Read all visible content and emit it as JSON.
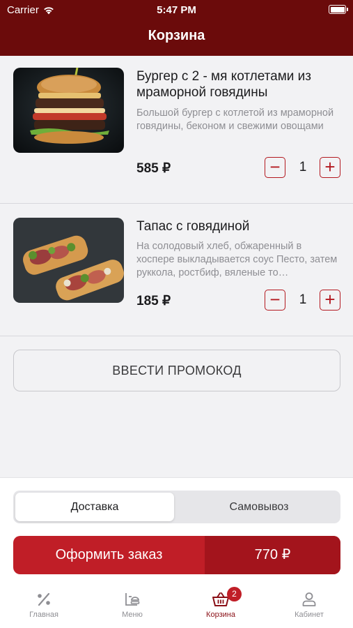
{
  "status_bar": {
    "carrier": "Carrier",
    "time": "5:47 PM"
  },
  "header": {
    "title": "Корзина"
  },
  "cart": {
    "items": [
      {
        "name": "Бургер с 2 - мя котлетами из мраморной говядины",
        "description": "Большой бургер с котлетой из мраморной говядины, беконом и свежими овощами",
        "price": "585 ₽",
        "quantity": "1",
        "image_icon": "burger-photo"
      },
      {
        "name": "Тапас с говядиной",
        "description": "На солодовый хлеб, обжаренный в хоспере выкладывается соус Песто, затем руккола, ростбиф, вяленые то…",
        "price": "185 ₽",
        "quantity": "1",
        "image_icon": "tapas-photo"
      }
    ],
    "minus_symbol": "−",
    "plus_symbol": "+"
  },
  "promo": {
    "label": "ВВЕСТИ ПРОМОКОД"
  },
  "delivery_toggle": {
    "delivery": "Доставка",
    "pickup": "Самовывоз",
    "selected": "Доставка"
  },
  "checkout": {
    "label": "Оформить заказ",
    "total": "770 ₽"
  },
  "tabbar": {
    "tabs": [
      {
        "label": "Главная",
        "icon": "percent-icon"
      },
      {
        "label": "Меню",
        "icon": "menu-food-icon"
      },
      {
        "label": "Корзина",
        "icon": "basket-icon",
        "badge": "2"
      },
      {
        "label": "Кабинет",
        "icon": "user-icon"
      }
    ],
    "active": "Корзина"
  },
  "colors": {
    "header": "#6b0b0b",
    "accent": "#c01e27",
    "accent_dark": "#a3141c"
  }
}
